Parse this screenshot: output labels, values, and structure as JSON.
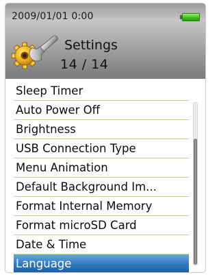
{
  "status": {
    "datetime": "2009/01/01   0:00",
    "battery_level": 1.0
  },
  "header": {
    "icon": "settings-gear-wrench-icon",
    "title": "Settings",
    "counter": "14 / 14"
  },
  "menu": {
    "items": [
      {
        "label": "Sleep Timer",
        "selected": false
      },
      {
        "label": "Auto Power Off",
        "selected": false
      },
      {
        "label": "Brightness",
        "selected": false
      },
      {
        "label": "USB Connection Type",
        "selected": false
      },
      {
        "label": "Menu Animation",
        "selected": false
      },
      {
        "label": "Default Background Im...",
        "selected": false
      },
      {
        "label": "Format Internal Memory",
        "selected": false
      },
      {
        "label": "Format microSD Card",
        "selected": false
      },
      {
        "label": "Date & Time",
        "selected": false
      },
      {
        "label": "Language",
        "selected": true
      }
    ]
  },
  "scrollbar": {
    "position_fraction": 1.0,
    "visible_fraction": 0.78
  },
  "colors": {
    "selection": "#2d78bd",
    "divider": "#b9d7a0",
    "battery": "#3cbf1c"
  }
}
